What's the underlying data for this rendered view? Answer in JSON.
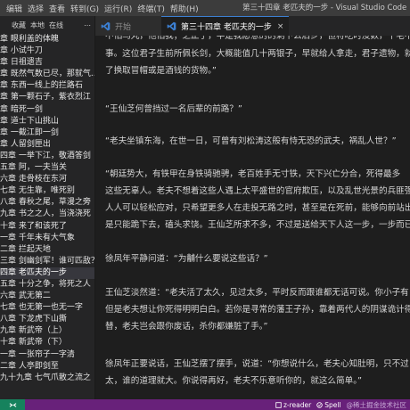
{
  "menu": [
    "编辑",
    "选择",
    "查看",
    "转到(G)",
    "运行(R)",
    "终端(T)",
    "帮助(H)"
  ],
  "window_title": "第三十四章 老匹夫的一步 - Visual Studio Code",
  "sidebar": {
    "tabs": [
      "收藏",
      "本地",
      "在线"
    ],
    "more": "⋯",
    "chapters": [
      "章 眼利盖的体魄",
      "章 小试牛刀",
      "章 日祖遗吉",
      "章 既然气数已尽，那就气...",
      "章 东西一线上的拦路石",
      "章 第一颗石子，紫衣烈江",
      "章 暗死一剑",
      "章 道士下山挑山",
      "章 一截江即一剑",
      "章 人留剑匣出",
      "四章 一举下江，敬酒答剑",
      "五章 阿，一夫当关",
      "六章 走骨枝在东河",
      "七章 无生靠，唯死别",
      "八章 春秋之尾，草漫之旁",
      "九章 书之之人，当浇浇死",
      "十章 来了和该死了",
      "一章 千年未有大气象",
      "二章 拦起天地",
      "三章 剑幽剑军！谁可匹敌？",
      "四章 老匹夫的一步",
      "五章 十分之争，将死之人",
      "六章 武无第二",
      "七章 也无第一也无一字",
      "八章 下龙虎下山撕",
      "九章 新武帝（上）",
      "十章 新武帝（下）",
      "一章 一张帘子一字清",
      "二章 人亭即剑至",
      "九十九章 七气爪散之流之"
    ],
    "active_index": 20
  },
  "tabs": {
    "start_label": "开始",
    "active_label": "第三十四章 老匹夫的一步",
    "close": "×"
  },
  "content": {
    "paragraphs": [
      "不怕乌丸，他怕我；之止了，半是我愿意的的剩下么后乡，但将吃时没数，干毛不嫌它？",
      "事。这位君子生前所佩长剑，大概能值几十两银子，早就给人拿走，君子遗物，就",
      "了换取冒帽或是酒钱的货物。”",
      "“王仙芝何曾挡过一名后辈的前路？”",
      "“老夫坐镇东海，在世一日，可曾有刘松涛这般有恃无恐的武夫，祸乱人世？”",
      "“朝廷势大，有铁甲在身铁骑驰骋，老百姓手无寸铁，天下兴亡分合，死得最多",
      "这些无辜人。老夫不想着这些人遇上太平盛世的官府欺压，以及乱世光景的兵匪强",
      "人人可以轻松应对，只希望更多人在走投无路之时，甚至是在死前，能够向前站出",
      "是只能跪下去，磕头求饶。王仙芝所求不多，不过是送给天下人这一步，一步而已",
      "徐凤年平静问道：“为黼什么要说这些话？”",
      "王仙芝淡然道：“老夫活了太久，见过太多，平时反而跟谁都无话可说。你小子有",
      "但是老夫想让你死得明明白白。若你是寻常的藩王子孙，靠着两代人的阴谋诡计得",
      "替，老夫岂会跟你废话，杀你都嫌脏了手。”",
      "徐凤年正要说话，王仙芝摆了摆手，说道：“你想说什么，老夫心知肚明，只不过",
      "太，谁的道理就大。你说得再好，老夫不乐意听你的，就这么简单。”"
    ]
  },
  "status": {
    "reader": "z-reader",
    "spell": "Spell",
    "watermark": "@稀土掘金技术社区"
  },
  "colors": {
    "title_bar": "#3c3c3c",
    "sidebar_bg": "#252526",
    "editor_bg": "#1e1e1e",
    "status_bar": "#68217a",
    "remote_indicator": "#16825d",
    "active_item": "#37373d",
    "vscode_blue": "#3c7fd1"
  }
}
